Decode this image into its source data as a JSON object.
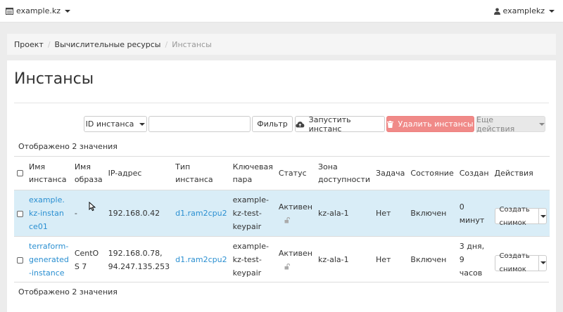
{
  "topbar": {
    "project": "example.kz",
    "user": "examplekz"
  },
  "breadcrumb": {
    "items": [
      "Проект",
      "Вычислительные ресурсы"
    ],
    "active": "Инстансы"
  },
  "page": {
    "title": "Инстансы"
  },
  "toolbar": {
    "filter_select": "ID инстанса",
    "search_value": "",
    "filter_button": "Фильтр",
    "launch_button": "Запустить инстанс",
    "delete_button": "Удалить инстансы",
    "more_button": "Еще действия"
  },
  "table": {
    "count_label": "Отображено 2 значения",
    "headers": [
      "Имя инстанса",
      "Имя образа",
      "IP-адрес",
      "Тип инстанса",
      "Ключевая пара",
      "Статус",
      "Зона доступности",
      "Задача",
      "Состояние",
      "Создан",
      "Действия"
    ],
    "rows": [
      {
        "name": "example.kz-instance01",
        "name_lines": [
          "example.",
          "kz-instan",
          "ce01"
        ],
        "image": "-",
        "image_lines": [
          "-"
        ],
        "ip_lines": [
          "192.168.0.42"
        ],
        "flavor": "d1.ram2cpu2",
        "keypair_lines": [
          "example-",
          "kz-test-",
          "keypair"
        ],
        "status": "Активен",
        "zone": "kz-ala-1",
        "task": "Нет",
        "power": "Включен",
        "created_lines": [
          "0 минут"
        ],
        "action": "Создать снимок",
        "highlighted": true
      },
      {
        "name": "terraform-generated-instance",
        "name_lines": [
          "terraform-",
          "generated",
          "-instance"
        ],
        "image": "CentOS 7",
        "image_lines": [
          "CentO",
          "S 7"
        ],
        "ip_lines": [
          "192.168.0.78,",
          "94.247.135.253"
        ],
        "flavor": "d1.ram2cpu2",
        "keypair_lines": [
          "example-",
          "kz-test-",
          "keypair"
        ],
        "status": "Активен",
        "zone": "kz-ala-1",
        "task": "Нет",
        "power": "Включен",
        "created_lines": [
          "3 дня,",
          "9 часов"
        ],
        "action": "Создать снимок",
        "highlighted": false
      }
    ]
  },
  "colors": {
    "link": "#2a8fd1",
    "row_highlight": "#d9edf7",
    "danger": "#f08a88"
  }
}
